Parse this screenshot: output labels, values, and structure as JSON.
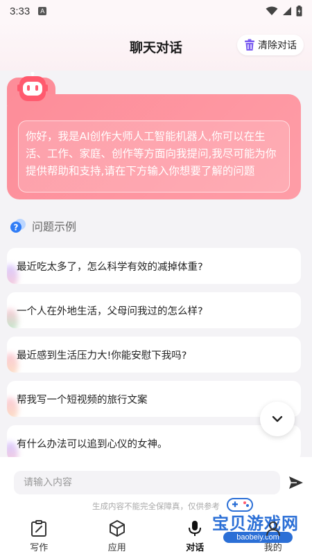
{
  "status_bar": {
    "time": "3:33",
    "a_label": "A"
  },
  "header": {
    "title": "聊天对话",
    "clear_label": "清除对话"
  },
  "welcome": {
    "text": "你好，我是AI创作大师人工智能机器人,你可以在生活、工作、家庭、创作等方面向我提问,我尽可能为你提供帮助和支持,请在下方输入你想要了解的问题"
  },
  "examples": {
    "title": "问题示例",
    "items": [
      {
        "text": "最近吃太多了，怎么科学有效的减掉体重?"
      },
      {
        "text": "一个人在外地生活，父母问我过的怎么样?"
      },
      {
        "text": "最近感到生活压力大!你能安慰下我吗?"
      },
      {
        "text": "帮我写一个短视频的旅行文案"
      },
      {
        "text": "有什么办法可以追到心仪的女神。"
      }
    ]
  },
  "input": {
    "placeholder": "请输入内容",
    "value": ""
  },
  "disclaimer": "生成内容不能完全保障真，仅供参考",
  "watermark": {
    "text": "宝贝游戏网",
    "url": "baobeiy.com"
  },
  "tabs": [
    {
      "label": "写作",
      "icon": "edit-clipboard-icon",
      "active": false
    },
    {
      "label": "应用",
      "icon": "cube-icon",
      "active": false
    },
    {
      "label": "对话",
      "icon": "microphone-icon",
      "active": true
    },
    {
      "label": "我的",
      "icon": "user-icon",
      "active": false
    }
  ],
  "colors": {
    "accent": "#fd8d99",
    "background": "#f4f3f6",
    "watermark": "#2b6fd6"
  }
}
